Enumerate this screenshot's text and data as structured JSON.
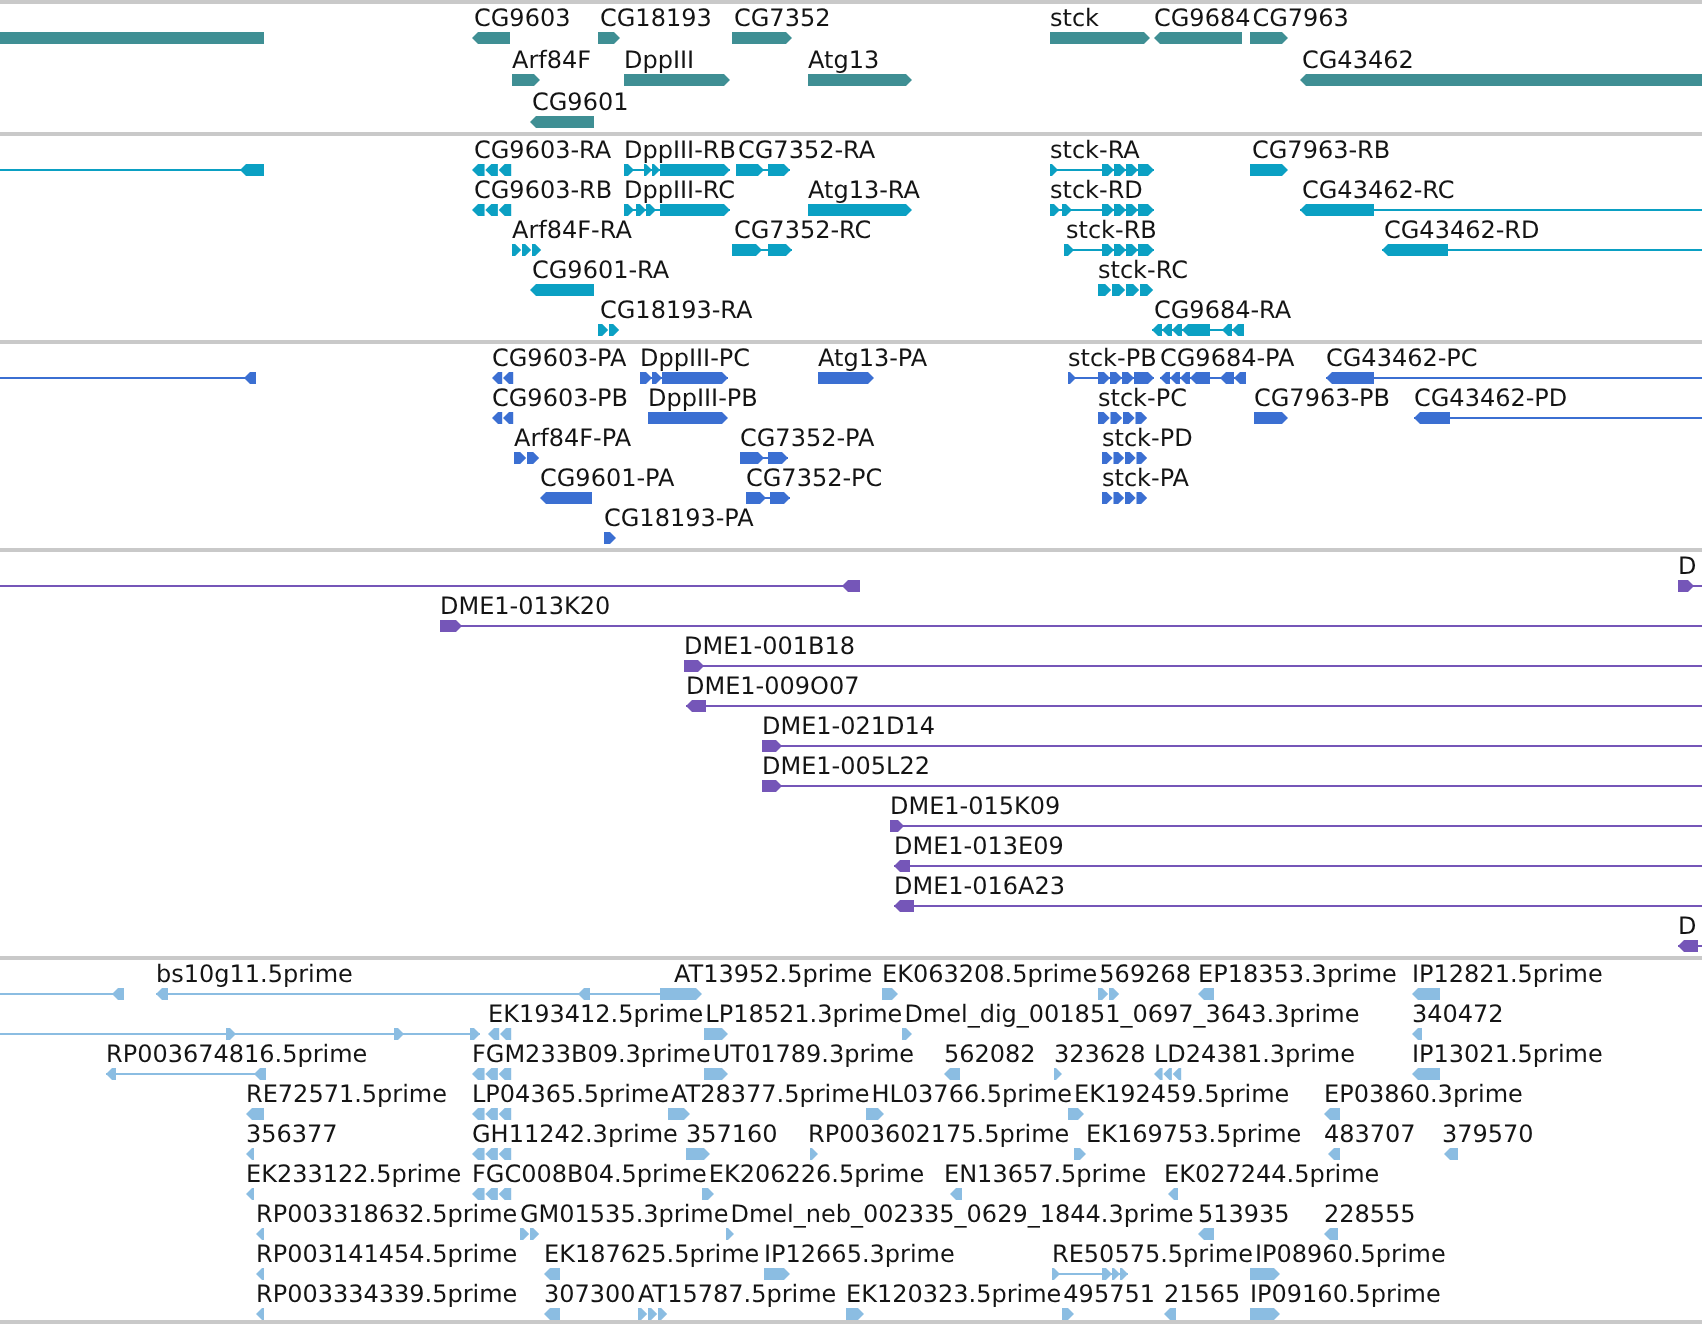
{
  "tracks": [
    {
      "kind": "gene",
      "features": [
        {
          "reverse": true
        },
        {
          "label": "CG9603",
          "reverse": true
        },
        {
          "label": "CG18193",
          "reverse": false
        },
        {
          "label": "CG7352",
          "reverse": false
        },
        {
          "label": "stck",
          "reverse": false
        },
        {
          "label": "CG9684",
          "reverse": true
        },
        {
          "label": "CG7963",
          "reverse": false
        },
        {
          "label": "Arf84F",
          "reverse": false
        },
        {
          "label": "DppIII",
          "reverse": false
        },
        {
          "label": "Atg13",
          "reverse": false
        },
        {
          "label": "CG43462",
          "reverse": true
        },
        {
          "label": "CG9601",
          "reverse": true
        }
      ]
    },
    {
      "kind": "transcript",
      "features": [
        {
          "reverse": true
        },
        {
          "label": "CG9603-RA",
          "reverse": true
        },
        {
          "label": "DppIII-RB",
          "reverse": false
        },
        {
          "label": "CG7352-RA",
          "reverse": false
        },
        {
          "label": "stck-RA",
          "reverse": false
        },
        {
          "label": "CG7963-RB",
          "reverse": false
        },
        {
          "label": "CG9603-RB",
          "reverse": true
        },
        {
          "label": "DppIII-RC",
          "reverse": false
        },
        {
          "label": "Atg13-RA",
          "reverse": false
        },
        {
          "label": "stck-RD",
          "reverse": false
        },
        {
          "label": "CG43462-RC",
          "reverse": true
        },
        {
          "label": "Arf84F-RA",
          "reverse": false
        },
        {
          "label": "CG7352-RC",
          "reverse": false
        },
        {
          "label": "stck-RB",
          "reverse": false
        },
        {
          "label": "CG43462-RD",
          "reverse": true
        },
        {
          "label": "CG9601-RA",
          "reverse": true
        },
        {
          "label": "stck-RC",
          "reverse": false
        },
        {
          "label": "CG18193-RA",
          "reverse": false
        },
        {
          "label": "CG9684-RA",
          "reverse": true
        }
      ]
    },
    {
      "kind": "cds",
      "features": [
        {
          "reverse": true
        },
        {
          "label": "CG9603-PA",
          "reverse": true
        },
        {
          "label": "DppIII-PC",
          "reverse": false
        },
        {
          "label": "Atg13-PA",
          "reverse": false
        },
        {
          "label": "stck-PB",
          "reverse": false
        },
        {
          "label": "CG9684-PA",
          "reverse": true
        },
        {
          "label": "CG43462-PC",
          "reverse": true
        },
        {
          "label": "CG9603-PB",
          "reverse": true
        },
        {
          "label": "DppIII-PB",
          "reverse": false
        },
        {
          "label": "stck-PC",
          "reverse": false
        },
        {
          "label": "CG7963-PB",
          "reverse": false
        },
        {
          "label": "CG43462-PD",
          "reverse": true
        },
        {
          "label": "Arf84F-PA",
          "reverse": false
        },
        {
          "label": "CG7352-PA",
          "reverse": false
        },
        {
          "label": "stck-PD",
          "reverse": false
        },
        {
          "label": "CG9601-PA",
          "reverse": true
        },
        {
          "label": "CG7352-PC",
          "reverse": false
        },
        {
          "label": "stck-PA",
          "reverse": false
        },
        {
          "label": "CG18193-PA",
          "reverse": false
        }
      ]
    },
    {
      "kind": "bac",
      "features": [
        {
          "reverse": true
        },
        {
          "label": "D",
          "reverse": false
        },
        {
          "label": "DME1-013K20",
          "reverse": false
        },
        {
          "label": "DME1-001B18",
          "reverse": false
        },
        {
          "label": "DME1-009O07",
          "reverse": true
        },
        {
          "label": "DME1-021D14",
          "reverse": false
        },
        {
          "label": "DME1-005L22",
          "reverse": false
        },
        {
          "label": "DME1-015K09",
          "reverse": false
        },
        {
          "label": "DME1-013E09",
          "reverse": true
        },
        {
          "label": "DME1-016A23",
          "reverse": true
        },
        {
          "label": "D",
          "reverse": true
        }
      ]
    },
    {
      "kind": "est",
      "features": [
        {
          "reverse": true
        },
        {
          "label": "bs10g11.5prime",
          "reverse": true
        },
        {
          "label": "AT13952.5prime",
          "reverse": false
        },
        {
          "label": "EK063208.5prime",
          "reverse": false
        },
        {
          "label": "569268",
          "reverse": false
        },
        {
          "label": "EP18353.3prime",
          "reverse": true
        },
        {
          "label": "IP12821.5prime",
          "reverse": true
        },
        {
          "reverse": false
        },
        {
          "label": "EK193412.5prime",
          "reverse": true
        },
        {
          "label": "LP18521.3prime",
          "reverse": false
        },
        {
          "label": "Dmel_dig_001851_0697_3643.3prime",
          "reverse": false
        },
        {
          "label": "340472",
          "reverse": true
        },
        {
          "label": "RP003674816.5prime",
          "reverse": true
        },
        {
          "label": "FGM233B09.3prime",
          "reverse": true
        },
        {
          "label": "UT01789.3prime",
          "reverse": false
        },
        {
          "label": "562082",
          "reverse": true
        },
        {
          "label": "323628",
          "reverse": false
        },
        {
          "label": "LD24381.3prime",
          "reverse": true
        },
        {
          "label": "IP13021.5prime",
          "reverse": true
        },
        {
          "label": "RE72571.5prime",
          "reverse": true
        },
        {
          "label": "LP04365.5prime",
          "reverse": true
        },
        {
          "label": "AT28377.5prime",
          "reverse": false
        },
        {
          "label": "HL03766.5prime",
          "reverse": false
        },
        {
          "label": "EK192459.5prime",
          "reverse": false
        },
        {
          "label": "EP03860.3prime",
          "reverse": true
        },
        {
          "label": "356377",
          "reverse": true
        },
        {
          "label": "GH11242.3prime",
          "reverse": true
        },
        {
          "label": "357160",
          "reverse": false
        },
        {
          "label": "RP003602175.5prime",
          "reverse": false
        },
        {
          "label": "EK169753.5prime",
          "reverse": false
        },
        {
          "label": "483707",
          "reverse": true
        },
        {
          "label": "379570",
          "reverse": true
        },
        {
          "label": "EK233122.5prime",
          "reverse": true
        },
        {
          "label": "FGC008B04.5prime",
          "reverse": true
        },
        {
          "label": "EK206226.5prime",
          "reverse": false
        },
        {
          "label": "EN13657.5prime",
          "reverse": true
        },
        {
          "label": "EK027244.5prime",
          "reverse": true
        },
        {
          "label": "RP003318632.5prime",
          "reverse": true
        },
        {
          "label": "GM01535.3prime",
          "reverse": false
        },
        {
          "label": "Dmel_neb_002335_0629_1844.3prime",
          "reverse": false
        },
        {
          "label": "513935",
          "reverse": true
        },
        {
          "label": "228555",
          "reverse": true
        },
        {
          "label": "RP003141454.5prime",
          "reverse": true
        },
        {
          "label": "EK187625.5prime",
          "reverse": true
        },
        {
          "label": "IP12665.3prime",
          "reverse": false
        },
        {
          "label": "RE50575.5prime",
          "reverse": false
        },
        {
          "label": "IP08960.5prime",
          "reverse": false
        },
        {
          "label": "RP003334339.5prime",
          "reverse": true
        },
        {
          "label": "307300",
          "reverse": true
        },
        {
          "label": "AT15787.5prime",
          "reverse": false
        },
        {
          "label": "EK120323.5prime",
          "reverse": false
        },
        {
          "label": "495751",
          "reverse": false
        },
        {
          "label": "21565",
          "reverse": true
        },
        {
          "label": "IP09160.5prime",
          "reverse": false
        }
      ]
    }
  ]
}
